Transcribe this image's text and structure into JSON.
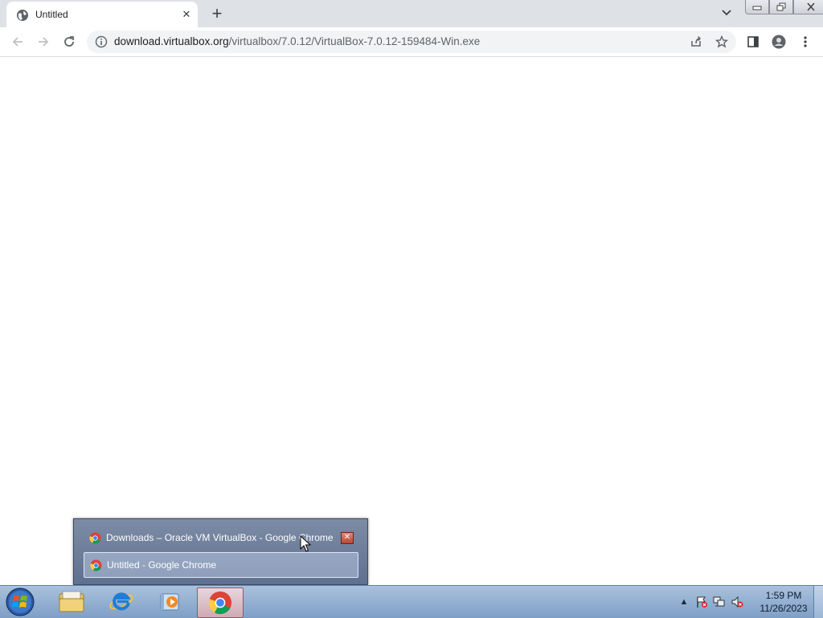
{
  "browser": {
    "tab": {
      "title": "Untitled"
    },
    "toolbar": {
      "url_host": "download.virtualbox.org",
      "url_path": "/virtualbox/7.0.12/VirtualBox-7.0.12-159484-Win.exe"
    }
  },
  "taskbar": {
    "thumbnail_popup": {
      "items": [
        {
          "label": "Downloads – Oracle VM VirtualBox - Google Chrome"
        },
        {
          "label": "Untitled - Google Chrome"
        }
      ]
    },
    "pinned_apps": [
      "windows-explorer-icon",
      "internet-explorer-icon",
      "media-player-icon",
      "chrome-icon"
    ],
    "clock": {
      "time": "1:59 PM",
      "date": "11/26/2023"
    }
  },
  "colors": {
    "tabstrip": "#dee1e6",
    "omnibox": "#f1f3f4",
    "taskbar": "#8fabd0"
  }
}
